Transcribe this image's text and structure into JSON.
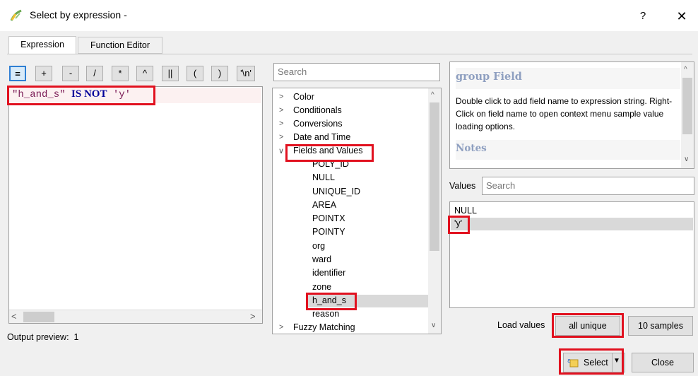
{
  "window": {
    "title": "Select by expression -",
    "help": "?",
    "close": "✕"
  },
  "tabs": [
    {
      "label": "Expression"
    },
    {
      "label": "Function Editor"
    }
  ],
  "operators": [
    "=",
    "+",
    "-",
    "/",
    "*",
    "^",
    "||",
    "(",
    ")",
    "'\\n'"
  ],
  "expression": {
    "field": "\"h_and_s\"",
    "keyword": "IS NOT",
    "value": "'y'"
  },
  "output_preview": {
    "label": "Output preview:",
    "value": "1"
  },
  "function_search": {
    "placeholder": "Search"
  },
  "function_tree": {
    "groups_top": [
      "Color",
      "Conditionals",
      "Conversions",
      "Date and Time"
    ],
    "expanded_group": "Fields and Values",
    "fields": [
      "POLY_ID",
      "NULL",
      "UNIQUE_ID",
      "AREA",
      "POINTX",
      "POINTY",
      "org",
      "ward",
      "identifier",
      "zone",
      "h_and_s",
      "reason"
    ],
    "groups_bottom": [
      "Fuzzy Matching"
    ]
  },
  "help": {
    "title": "group Field",
    "body": "Double click to add field name to expression string. Right-Click on field name to open context menu sample value loading options.",
    "notes_title": "Notes"
  },
  "values": {
    "label": "Values",
    "search_placeholder": "Search",
    "items": [
      "NULL",
      "'y'"
    ]
  },
  "load_values": {
    "label": "Load values",
    "all_unique": "all unique",
    "samples": "10 samples"
  },
  "footer": {
    "select": "Select",
    "close": "Close"
  },
  "colors": {
    "highlight": "#e1111f",
    "accent": "#2f7fd3"
  }
}
